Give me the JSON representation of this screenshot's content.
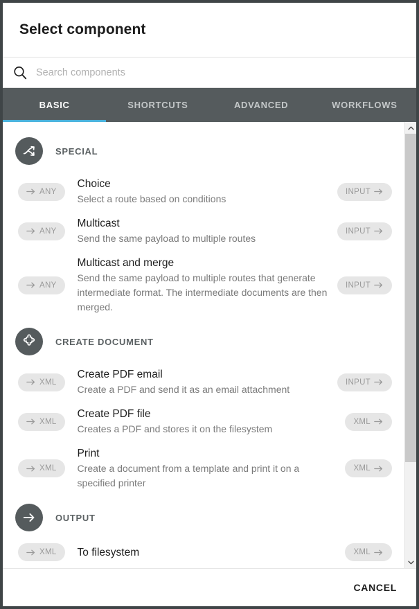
{
  "dialog": {
    "title": "Select component",
    "cancel_label": "CANCEL"
  },
  "search": {
    "placeholder": "Search components",
    "value": "",
    "icon": "search-icon"
  },
  "tabs": [
    {
      "label": "BASIC",
      "active": true
    },
    {
      "label": "SHORTCUTS",
      "active": false
    },
    {
      "label": "ADVANCED",
      "active": false
    },
    {
      "label": "WORKFLOWS",
      "active": false
    }
  ],
  "sections": [
    {
      "title": "SPECIAL",
      "icon": "route-split-icon",
      "rows": [
        {
          "input_badge": "ANY",
          "title": "Choice",
          "desc": "Select a route based on conditions",
          "output_badge": "INPUT"
        },
        {
          "input_badge": "ANY",
          "title": "Multicast",
          "desc": "Send the same payload to multiple routes",
          "output_badge": "INPUT"
        },
        {
          "input_badge": "ANY",
          "title": "Multicast and merge",
          "desc": "Send the same payload to multiple routes that generate intermediate format. The intermediate documents are then merged.",
          "output_badge": "INPUT"
        }
      ]
    },
    {
      "title": "CREATE DOCUMENT",
      "icon": "puzzle-piece-icon",
      "rows": [
        {
          "input_badge": "XML",
          "title": "Create PDF email",
          "desc": "Create a PDF and send it as an email attachment",
          "output_badge": "INPUT"
        },
        {
          "input_badge": "XML",
          "title": "Create PDF file",
          "desc": "Creates a PDF and stores it on the filesystem",
          "output_badge": "XML"
        },
        {
          "input_badge": "XML",
          "title": "Print",
          "desc": "Create a document from a template and print it on a specified printer",
          "output_badge": "XML"
        }
      ]
    },
    {
      "title": "OUTPUT",
      "icon": "arrow-right-icon",
      "rows": [
        {
          "input_badge": "XML",
          "title": "To filesystem",
          "desc": "",
          "output_badge": "XML"
        }
      ]
    }
  ],
  "scrollbar": {
    "up_icon": "chevron-up-icon",
    "down_icon": "chevron-down-icon"
  },
  "colors": {
    "accent": "#4ab3dd",
    "tabbar": "#555b5d",
    "section_icon": "#555b5d",
    "badge_bg": "#e6e6e6",
    "badge_text": "#9a9a9a"
  }
}
